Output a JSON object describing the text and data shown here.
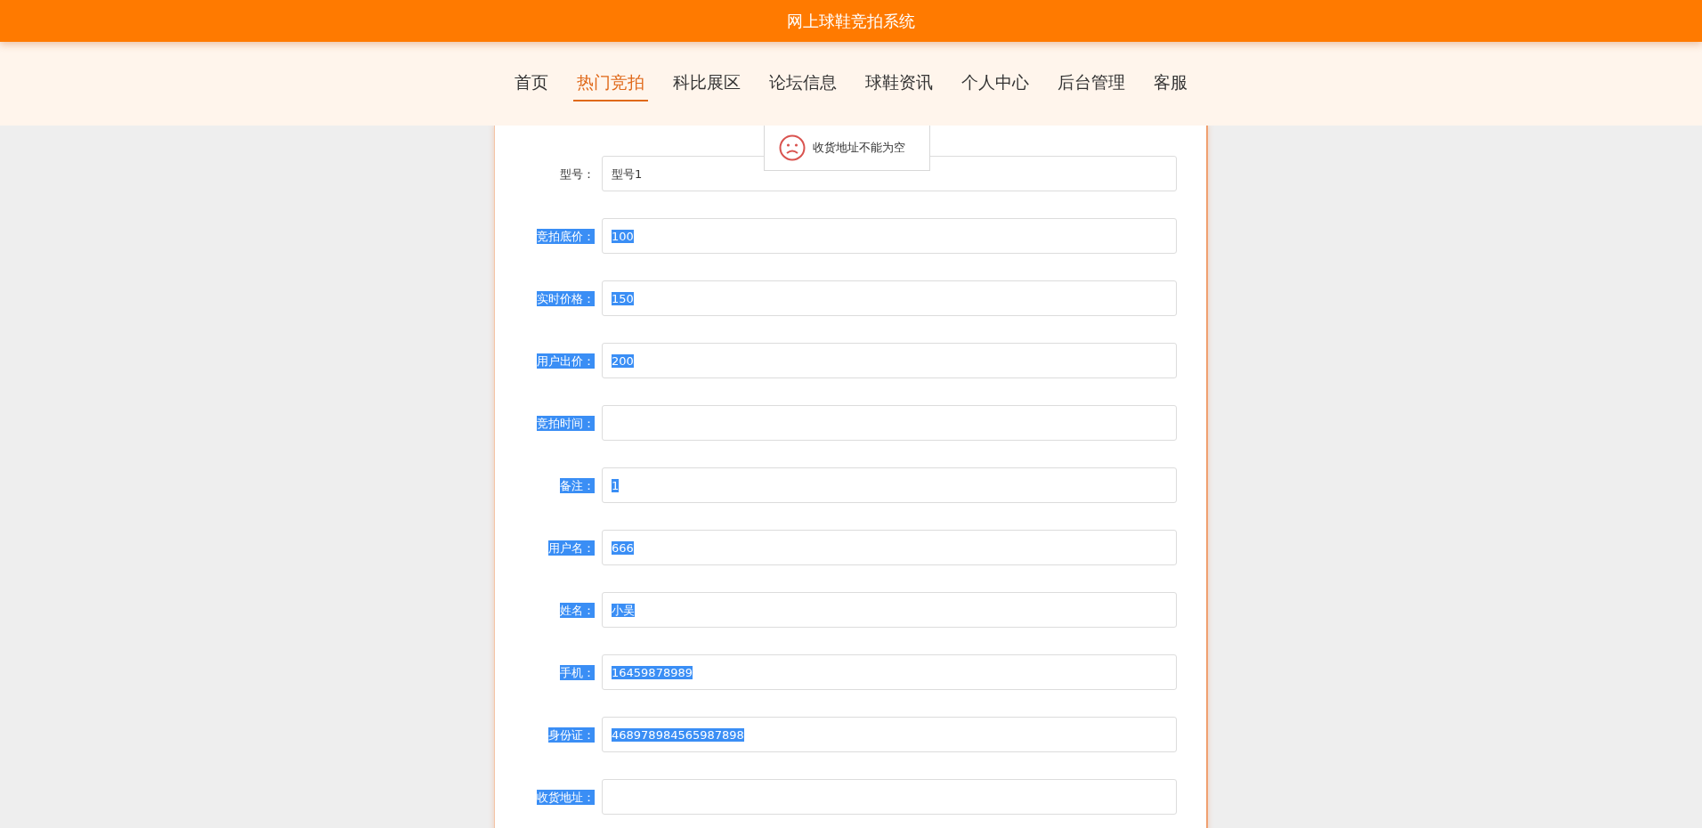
{
  "header": {
    "title": "网上球鞋竞拍系统"
  },
  "nav": [
    {
      "label": "首页",
      "selected": false
    },
    {
      "label": "热门竞拍",
      "selected": true
    },
    {
      "label": "科比展区",
      "selected": false
    },
    {
      "label": "论坛信息",
      "selected": false
    },
    {
      "label": "球鞋资讯",
      "selected": false
    },
    {
      "label": "个人中心",
      "selected": false
    },
    {
      "label": "后台管理",
      "selected": false
    },
    {
      "label": "客服",
      "selected": false
    }
  ],
  "toast": {
    "message": "收货地址不能为空"
  },
  "form": [
    {
      "label": "型号：",
      "value": "型号1",
      "selected": false
    },
    {
      "label": "竞拍底价：",
      "value": "100",
      "selected": true
    },
    {
      "label": "实时价格：",
      "value": "150",
      "selected": true
    },
    {
      "label": "用户出价：",
      "value": "200",
      "selected": true
    },
    {
      "label": "竞拍时间：",
      "selected": true
    },
    {
      "label": "备注：",
      "value": "1",
      "selected": true
    },
    {
      "label": "用户名：",
      "value": "666",
      "selected": true
    },
    {
      "label": "姓名：",
      "value": "小吴",
      "selected": true
    },
    {
      "label": "手机：",
      "value": "16459878989",
      "selected": true
    },
    {
      "label": "身份证：",
      "value": "468978984565987898",
      "selected": true
    },
    {
      "label": "收货地址：",
      "selected": true
    }
  ]
}
